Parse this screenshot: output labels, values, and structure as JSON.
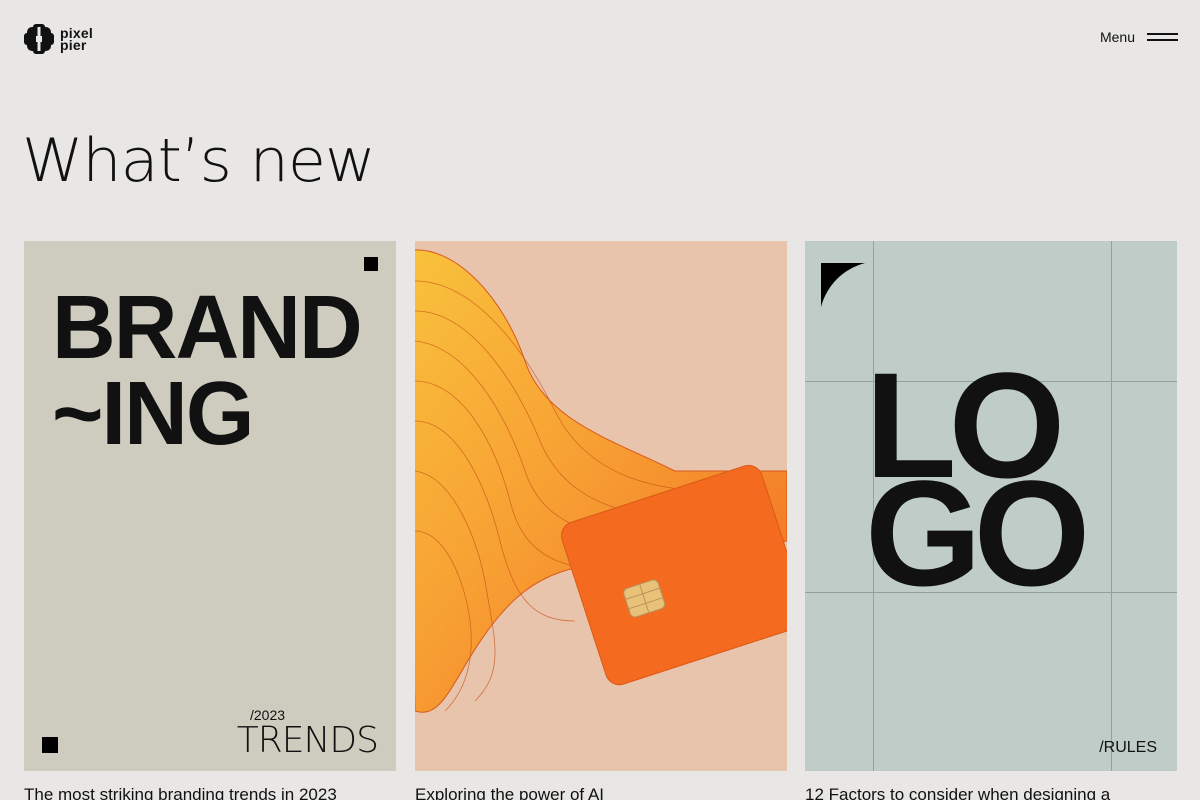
{
  "brand": {
    "name_line1": "pixel",
    "name_line2": "pier",
    "icon": "pixel-pier-logo-icon"
  },
  "header": {
    "menu_label": "Menu",
    "menu_icon": "hamburger-icon"
  },
  "page_title": "What’s new",
  "cards": [
    {
      "art_line1": "BRAND",
      "art_line2": "~ING",
      "art_year": "/2023",
      "art_word": "TRENDS",
      "caption": "The most striking branding trends in 2023"
    },
    {
      "caption": "Exploring the power of AI"
    },
    {
      "art_line1": "LO",
      "art_line2": "GO",
      "art_tag": "/RULES",
      "caption": "12 Factors to consider when designing a"
    }
  ],
  "colors": {
    "background": "#e8e7e5",
    "card1": "#cdccbf",
    "card2": "#e8c4ac",
    "card3": "#bfccc7",
    "accent_orange": "#f46a1f"
  }
}
